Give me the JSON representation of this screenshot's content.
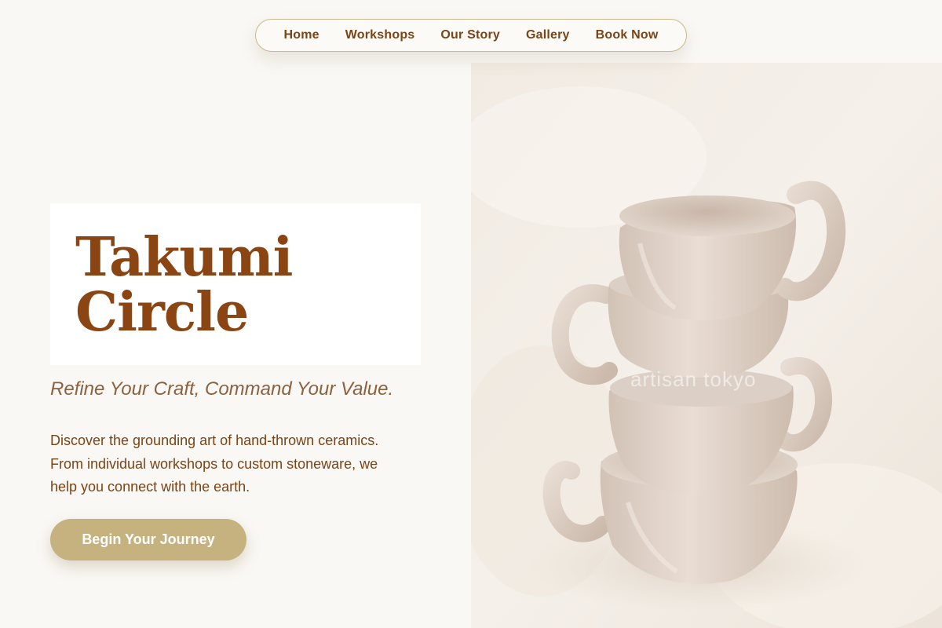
{
  "nav": {
    "items": [
      {
        "label": "Home"
      },
      {
        "label": "Workshops"
      },
      {
        "label": "Our Story"
      },
      {
        "label": "Gallery"
      },
      {
        "label": "Book Now"
      }
    ]
  },
  "hero": {
    "title_line1": "Takumi",
    "title_line2": "Circle",
    "tagline": "Refine Your Craft, Command Your Value.",
    "description": "Discover the grounding art of hand-thrown ceramics. From individual workshops to custom stoneware, we help you connect with the earth.",
    "cta_label": "Begin Your Journey",
    "image_watermark": "artisan tokyo"
  },
  "colors": {
    "brand_brown": "#8b4513",
    "accent_gold": "#c5b27f",
    "page_background": "#faf8f5",
    "nav_border": "#c9b98a"
  },
  "icons": {
    "hero_image": "stacked-ceramic-cups-photo"
  }
}
